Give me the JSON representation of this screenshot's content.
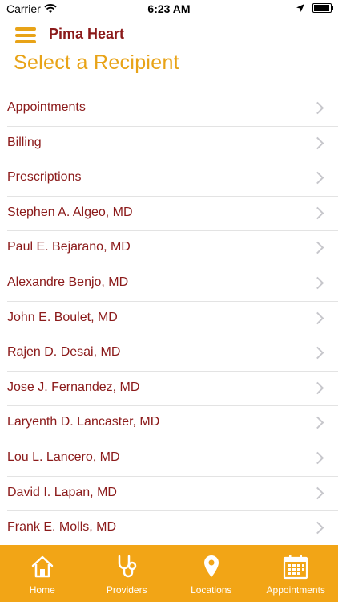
{
  "status_bar": {
    "carrier": "Carrier",
    "time": "6:23 AM"
  },
  "header": {
    "app_title": "Pima Heart",
    "page_title": "Select a Recipient"
  },
  "recipients": [
    {
      "label": "Appointments"
    },
    {
      "label": "Billing"
    },
    {
      "label": "Prescriptions"
    },
    {
      "label": "Stephen A. Algeo, MD"
    },
    {
      "label": "Paul E. Bejarano, MD"
    },
    {
      "label": "Alexandre Benjo, MD"
    },
    {
      "label": "John E. Boulet, MD"
    },
    {
      "label": "Rajen D. Desai, MD"
    },
    {
      "label": "Jose J. Fernandez, MD"
    },
    {
      "label": "Laryenth D. Lancaster, MD"
    },
    {
      "label": "Lou L. Lancero, MD"
    },
    {
      "label": "David I. Lapan, MD"
    },
    {
      "label": "Frank E. Molls, MD"
    }
  ],
  "tab_bar": {
    "tabs": [
      {
        "label": "Home",
        "icon": "home-icon"
      },
      {
        "label": "Providers",
        "icon": "stethoscope-icon"
      },
      {
        "label": "Locations",
        "icon": "location-pin-icon"
      },
      {
        "label": "Appointments",
        "icon": "calendar-icon"
      }
    ]
  },
  "colors": {
    "accent": "#E8A317",
    "brand": "#8B1A1A",
    "tab_bar": "#F2A516"
  }
}
